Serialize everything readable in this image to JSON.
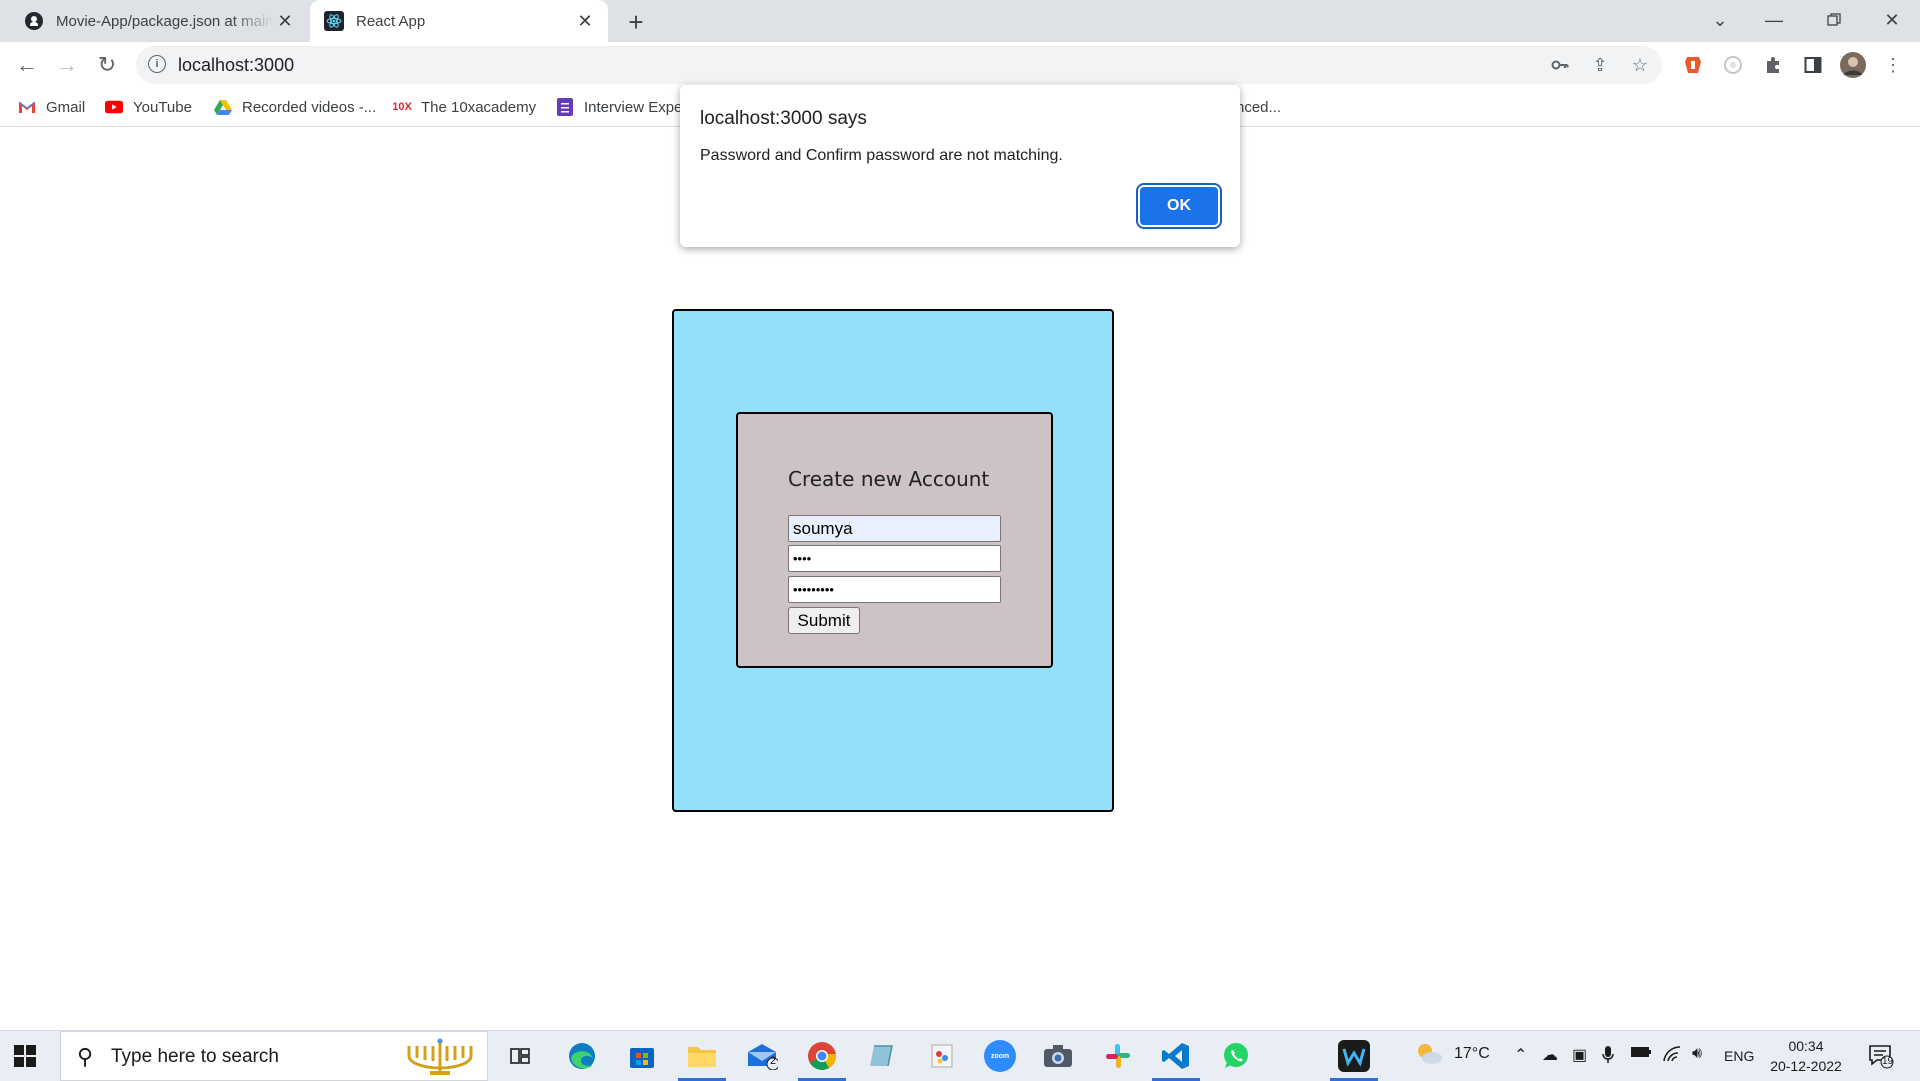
{
  "browser": {
    "tabs": [
      {
        "title": "Movie-App/package.json at main",
        "icon": "github-icon",
        "active": false
      },
      {
        "title": "React App",
        "icon": "react-icon",
        "active": true
      }
    ],
    "address": {
      "url": "localhost:3000"
    },
    "bookmarks": [
      {
        "label": "Gmail",
        "icon": "gmail-icon"
      },
      {
        "label": "YouTube",
        "icon": "youtube-icon"
      },
      {
        "label": "Recorded videos -...",
        "icon": "google-drive-icon"
      },
      {
        "label": "The 10xacademy",
        "icon": "10x-icon"
      },
      {
        "label": "Interview Expe",
        "icon": "form-icon"
      },
      {
        "label": "nced...",
        "icon": ""
      }
    ]
  },
  "alert": {
    "title": "localhost:3000 says",
    "message": "Password and Confirm password are not matching.",
    "ok_label": "OK"
  },
  "form": {
    "heading": "Create new Account",
    "username_value": "soumya",
    "password_mask": "••••",
    "confirm_mask": "•••••••••",
    "submit_label": "Submit"
  },
  "taskbar": {
    "search_placeholder": "Type here to search",
    "weather": "17°C",
    "language": "ENG",
    "time": "00:34",
    "date": "20-12-2022",
    "mail_badge": "2",
    "notification_count": "19"
  },
  "colors": {
    "outer_box": "#92e0fa",
    "inner_box": "#cdc3c5",
    "ok_button": "#1a73e8"
  }
}
